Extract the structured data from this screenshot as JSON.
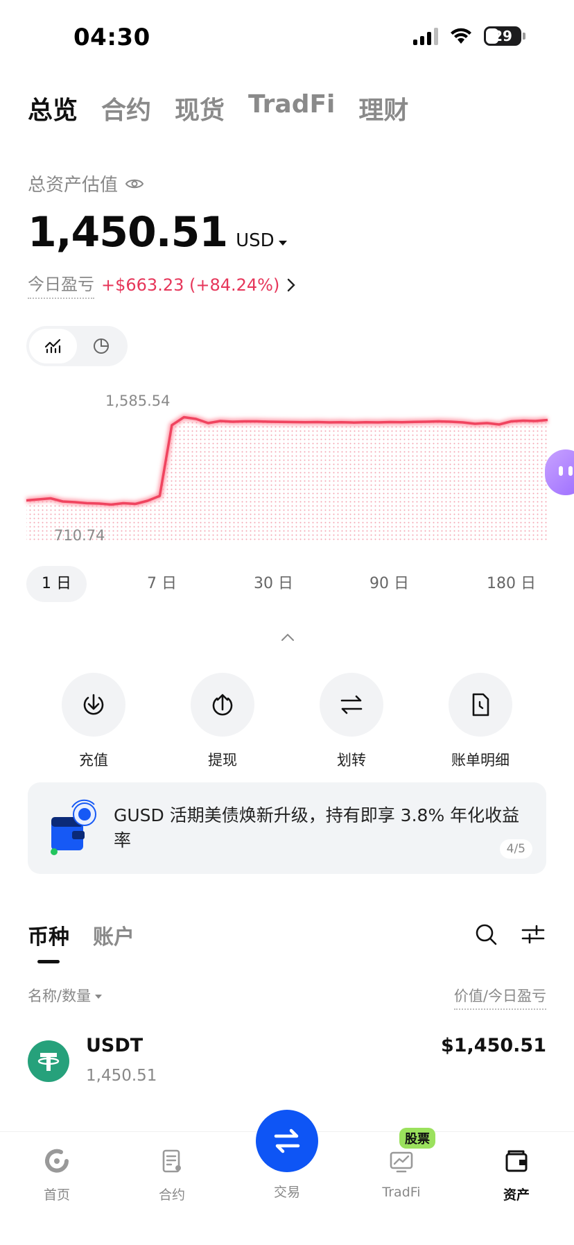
{
  "status_bar": {
    "time": "04:30",
    "battery": "29"
  },
  "top_tabs": [
    {
      "label": "总览",
      "active": true
    },
    {
      "label": "合约",
      "active": false
    },
    {
      "label": "现货",
      "active": false
    },
    {
      "label": "TradFi",
      "active": false
    },
    {
      "label": "理财",
      "active": false
    }
  ],
  "summary": {
    "total_label": "总资产估值",
    "total_value": "1,450.51",
    "currency": "USD",
    "pnl_label": "今日盈亏",
    "pnl_value": "+$663.23 (+84.24%)"
  },
  "chart": {
    "high_label": "1,585.54",
    "low_label": "710.74",
    "line_color": "#f0445f"
  },
  "chart_data": {
    "type": "line",
    "ylim": [
      700,
      1600
    ],
    "values": [
      785,
      800,
      815,
      770,
      760,
      745,
      740,
      725,
      745,
      735,
      780,
      850,
      1470,
      1585,
      1560,
      1500,
      1530,
      1520,
      1525,
      1525,
      1520,
      1518,
      1515,
      1512,
      1515,
      1510,
      1512,
      1508,
      1512,
      1510,
      1515,
      1512,
      1518,
      1520,
      1525,
      1520,
      1510,
      1490,
      1500,
      1480,
      1525,
      1535,
      1530,
      1545
    ],
    "high": "1,585.54",
    "low": "710.74"
  },
  "ranges": [
    {
      "label": "1 日",
      "active": true
    },
    {
      "label": "7 日",
      "active": false
    },
    {
      "label": "30 日",
      "active": false
    },
    {
      "label": "90 日",
      "active": false
    },
    {
      "label": "180 日",
      "active": false
    }
  ],
  "actions": {
    "deposit": "充值",
    "withdraw": "提现",
    "transfer": "划转",
    "statement": "账单明细"
  },
  "banner": {
    "text": "GUSD 活期美债焕新升级，持有即享 3.8% 年化收益率",
    "page": "4/5"
  },
  "asset_tabs": {
    "coins": "币种",
    "accounts": "账户"
  },
  "list_header": {
    "left": "名称/数量",
    "right": "价值/今日盈亏"
  },
  "assets": [
    {
      "name": "USDT",
      "amount": "1,450.51",
      "value": "$1,450.51"
    }
  ],
  "bottom_nav": {
    "home": "首页",
    "futures": "合约",
    "trade": "交易",
    "tradfi": "TradFi",
    "stock_badge": "股票",
    "assets": "资产"
  }
}
